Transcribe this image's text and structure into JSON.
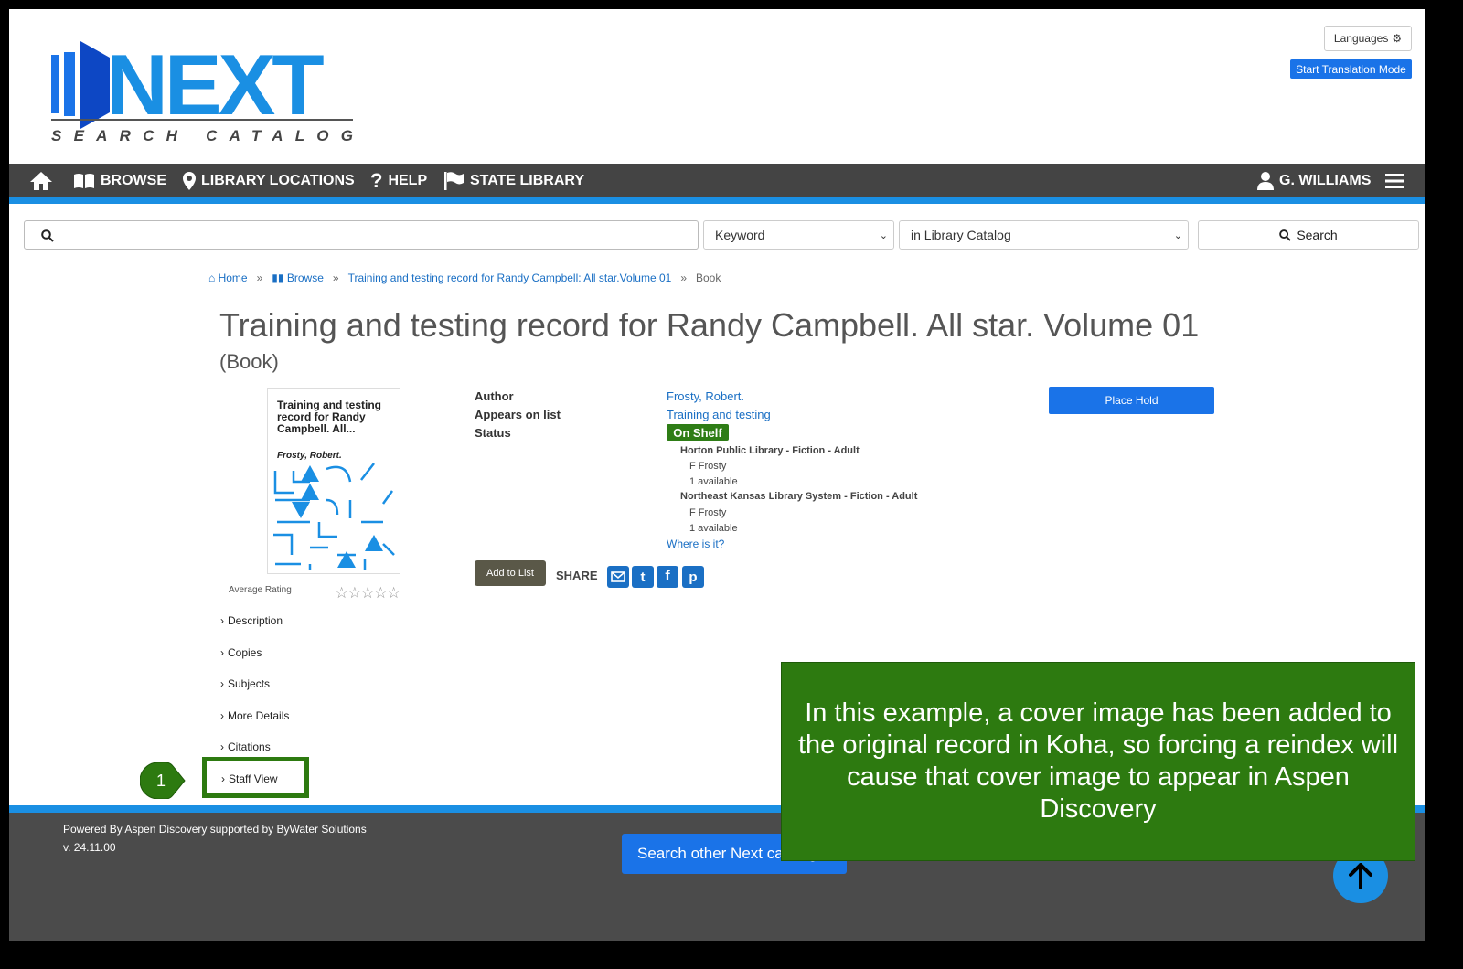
{
  "header": {
    "logo_main": "NEXT",
    "logo_sub": "SEARCH CATALOG",
    "languages_label": "Languages",
    "translation_label": "Start Translation Mode"
  },
  "nav": {
    "items": [
      {
        "label": "BROWSE"
      },
      {
        "label": "LIBRARY LOCATIONS"
      },
      {
        "label": "HELP"
      },
      {
        "label": "STATE LIBRARY"
      }
    ],
    "user_label": "G. WILLIAMS"
  },
  "search": {
    "query": "",
    "type_selected": "Keyword",
    "scope_selected": "in Library Catalog",
    "button_label": "Search"
  },
  "breadcrumb": {
    "home": "Home",
    "browse": "Browse",
    "list": "Training and testing record for Randy Campbell: All star.Volume 01",
    "current": "Book"
  },
  "record": {
    "title": "Training and testing record for Randy Campbell. All star. Volume 01",
    "format": "(Book)",
    "cover_title": "Training and testing record for Randy Campbell. All...",
    "cover_author": "Frosty, Robert.",
    "rating_label": "Average Rating",
    "author_label": "Author",
    "author_value": "Frosty, Robert.",
    "list_label": "Appears on list",
    "list_value": "Training and testing",
    "status_label": "Status",
    "status_value": "On Shelf",
    "holdings": [
      {
        "location": "Horton Public Library - Fiction - Adult",
        "call_number": "F Frosty",
        "available": "1 available"
      },
      {
        "location": "Northeast Kansas Library System - Fiction - Adult",
        "call_number": "F Frosty",
        "available": "1 available"
      }
    ],
    "where_label": "Where is it?",
    "place_hold_label": "Place Hold",
    "add_to_list_label": "Add to List",
    "share_label": "SHARE"
  },
  "sections": [
    {
      "label": "Description"
    },
    {
      "label": "Copies"
    },
    {
      "label": "Subjects"
    },
    {
      "label": "More Details"
    },
    {
      "label": "Citations"
    },
    {
      "label": "Staff View"
    }
  ],
  "footer": {
    "powered_by": "Powered By Aspen Discovery supported by ByWater Solutions",
    "version": "v. 24.11.00",
    "search_other_label": "Search other Next catalogs"
  },
  "annotation": {
    "step_number": "1",
    "callout_text": "In this example, a cover image has been added to the original record in Koha, so forcing a reindex will cause that cover image to appear in Aspen Discovery"
  },
  "colors": {
    "primary_blue": "#1a73e8",
    "stripe_blue": "#1a8fe3",
    "nav_gray": "#444444",
    "callout_green": "#2d7a10",
    "on_shelf_green": "#2e7d16"
  }
}
